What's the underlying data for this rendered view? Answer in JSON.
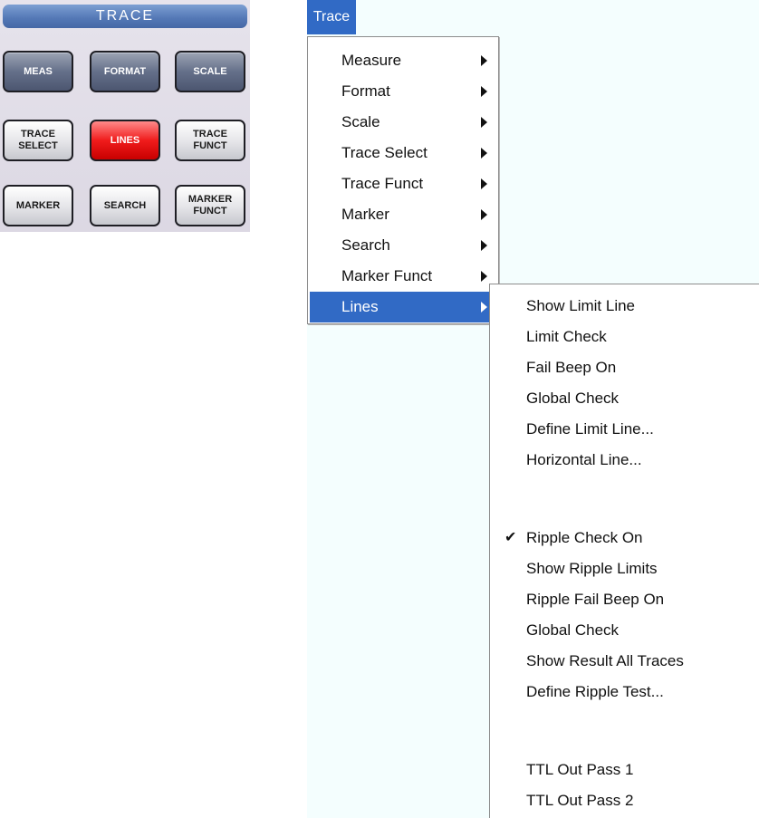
{
  "panel": {
    "title": "TRACE",
    "buttons": [
      {
        "label": "MEAS"
      },
      {
        "label": "FORMAT"
      },
      {
        "label": "SCALE"
      },
      {
        "label": "TRACE SELECT"
      },
      {
        "label": "LINES"
      },
      {
        "label": "TRACE FUNCT"
      },
      {
        "label": "MARKER"
      },
      {
        "label": "SEARCH"
      },
      {
        "label": "MARKER FUNCT"
      }
    ],
    "colors": {
      "active": "#f01c1c",
      "header": "#5377b5"
    }
  },
  "menubar": {
    "title": "Trace"
  },
  "menu": {
    "items": [
      {
        "label": "Measure"
      },
      {
        "label": "Format"
      },
      {
        "label": "Scale"
      },
      {
        "label": "Trace Select"
      },
      {
        "label": "Trace Funct"
      },
      {
        "label": "Marker"
      },
      {
        "label": "Search"
      },
      {
        "label": "Marker Funct"
      },
      {
        "label": "Lines"
      }
    ],
    "selected": "Lines",
    "highlight_color": "#316ac5"
  },
  "submenu": {
    "items": [
      {
        "label": "Show Limit Line"
      },
      {
        "label": "Limit Check"
      },
      {
        "label": "Fail Beep On"
      },
      {
        "label": "Global Check"
      },
      {
        "label": "Define Limit Line..."
      },
      {
        "label": "Horizontal Line..."
      },
      {
        "label": "Ripple Check On",
        "checked": true
      },
      {
        "label": "Show Ripple Limits"
      },
      {
        "label": "Ripple Fail Beep On"
      },
      {
        "label": "Global Check"
      },
      {
        "label": "Show Result All Traces"
      },
      {
        "label": "Define Ripple Test..."
      },
      {
        "label": "TTL Out Pass 1"
      },
      {
        "label": "TTL Out Pass 2"
      }
    ],
    "check_icon": "checkmark-icon"
  }
}
